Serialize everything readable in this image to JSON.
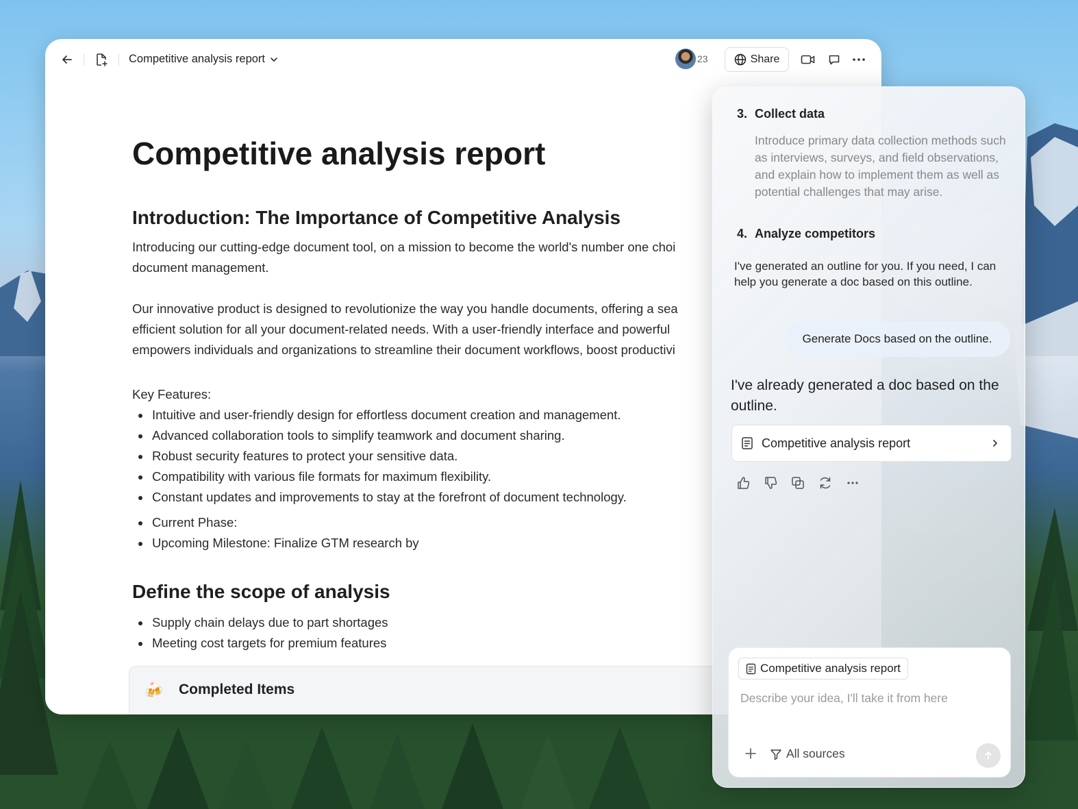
{
  "header": {
    "doc_title": "Competitive analysis report",
    "collaborator_count": "23",
    "share_label": "Share"
  },
  "doc": {
    "title": "Competitive analysis report",
    "intro_heading": "Introduction: The Importance of Competitive Analysis",
    "intro_para": "Introducing our cutting-edge document tool, on a mission to become the world's number one choi\ndocument management.",
    "product_para": "Our innovative product is designed to revolutionize the way you handle documents, offering a sea\nefficient solution for all your document-related needs. With a user-friendly interface and powerful\nempowers individuals and organizations to streamline their document workflows, boost productivi",
    "key_features_label": "Key Features:",
    "key_features": [
      "Intuitive and user-friendly design for effortless document creation and management.",
      "Advanced collaboration tools to simplify teamwork and document sharing.",
      "Robust security features to protect your sensitive data.",
      "Compatibility with various file formats for maximum flexibility.",
      "Constant updates and improvements to stay at the forefront of document technology."
    ],
    "status_items": [
      "Current Phase:",
      "Upcoming Milestone: Finalize GTM research by"
    ],
    "scope_heading": "Define the scope of analysis",
    "scope_items": [
      "Supply chain delays due to part shortages",
      "Meeting cost targets for premium features"
    ],
    "callout_icon": "🍻",
    "callout_title": "Completed Items"
  },
  "ai_panel": {
    "steps": [
      {
        "number": "3.",
        "title": "Collect data",
        "description": "Introduce primary data collection methods such as interviews, surveys, and field observations, and explain how to implement them as well as potential challenges that may arise."
      },
      {
        "number": "4.",
        "title": "Analyze competitors"
      }
    ],
    "outline_message": "I've generated an outline for you. If you need, I can help you generate a doc based on this outline.",
    "user_message": "Generate Docs based on the outline.",
    "reply": "I've already generated a doc based on the outline.",
    "doc_card_label": "Competitive analysis report",
    "composer": {
      "chip_label": "Competitive analysis report",
      "placeholder": "Describe your idea, I'll take it from here",
      "sources_label": "All sources"
    }
  },
  "colors": {
    "accent_bubble": "#e9f0fa",
    "text_primary": "#222222",
    "text_muted": "#888888"
  }
}
